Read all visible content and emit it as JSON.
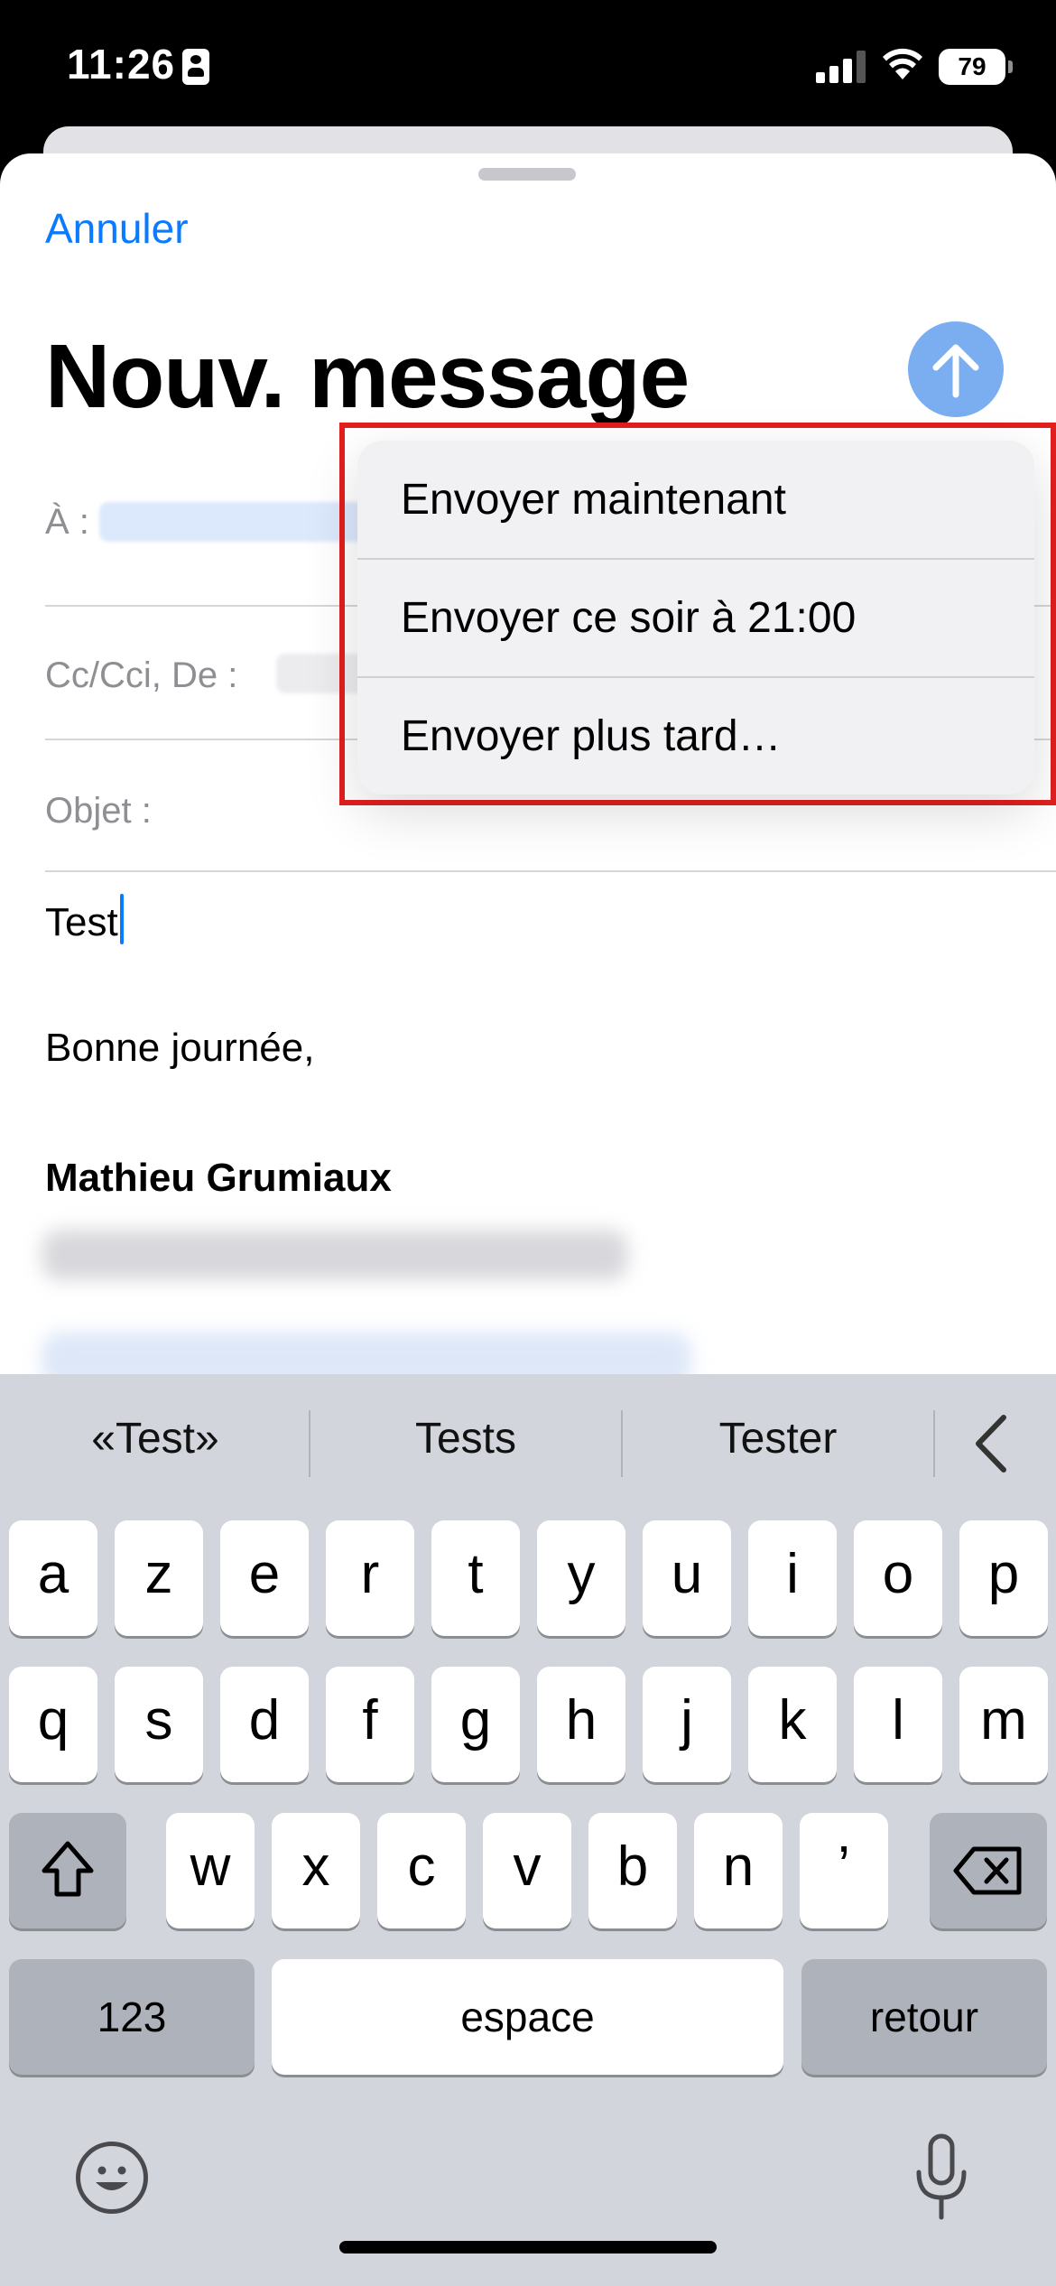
{
  "status_bar": {
    "time": "11:26",
    "battery": "79"
  },
  "compose": {
    "cancel_label": "Annuler",
    "title": "Nouv. message",
    "to_label": "À :",
    "cc_label": "Cc/Cci, De :",
    "subject_label": "Objet :",
    "body_first_line": "Test",
    "body_greeting": "Bonne journée,",
    "signature_name": "Mathieu Grumiaux"
  },
  "send_menu": {
    "items": [
      "Envoyer maintenant",
      "Envoyer ce soir à 21:00",
      "Envoyer plus tard…"
    ]
  },
  "keyboard": {
    "suggestions": [
      "«Test»",
      "Tests",
      "Tester"
    ],
    "row1": [
      "a",
      "z",
      "e",
      "r",
      "t",
      "y",
      "u",
      "i",
      "o",
      "p"
    ],
    "row2": [
      "q",
      "s",
      "d",
      "f",
      "g",
      "h",
      "j",
      "k",
      "l",
      "m"
    ],
    "row3": [
      "w",
      "x",
      "c",
      "v",
      "b",
      "n",
      "’"
    ],
    "numbers_key": "123",
    "space_key": "espace",
    "return_key": "retour"
  },
  "colors": {
    "accent": "#0a7aff",
    "highlight": "#e11f1f"
  }
}
